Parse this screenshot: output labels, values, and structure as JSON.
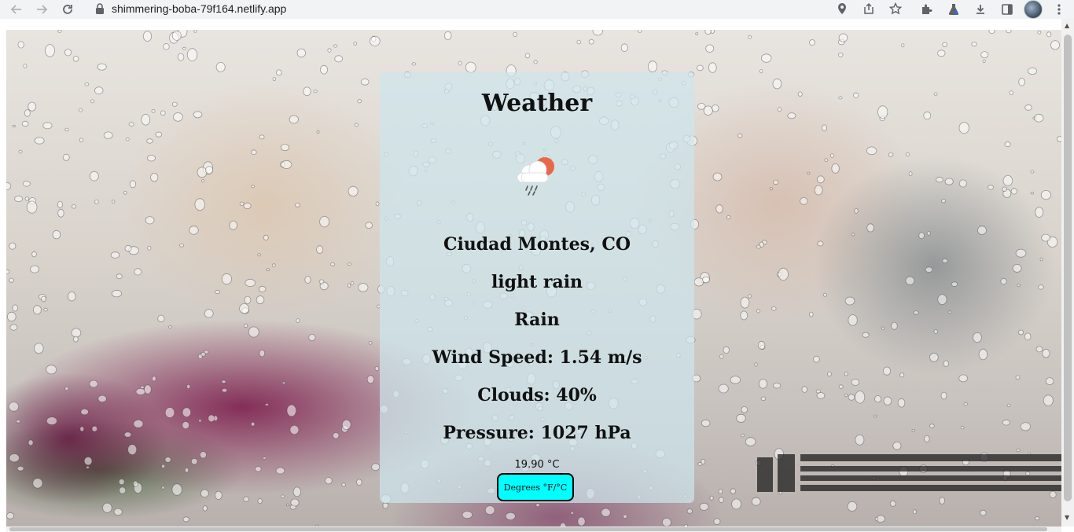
{
  "browser": {
    "url": "shimmering-boba-79f164.netlify.app",
    "icons": {
      "back": "arrow-left-icon",
      "forward": "arrow-right-icon",
      "reload": "reload-icon",
      "lock": "lock-icon",
      "location": "location-pin-icon",
      "share": "share-icon",
      "bookmark": "star-icon",
      "extensions": "puzzle-icon",
      "labs": "flask-icon",
      "download": "download-icon",
      "side_panel": "side-panel-icon",
      "menu": "kebab-menu-icon"
    }
  },
  "weather_card": {
    "title": "Weather",
    "icon": "cloud-rain-sun-icon",
    "location": "Ciudad Montes, CO",
    "description": "light rain",
    "main": "Rain",
    "wind": "Wind Speed: 1.54 m/s",
    "clouds": "Clouds: 40%",
    "pressure": "Pressure: 1027 hPa",
    "temperature": "19.90 °C",
    "unit_button": "Degrees °F/°C"
  },
  "colors": {
    "button_bg": "#00ffff",
    "card_bg": "rgba(205,228,236,0.72)",
    "sun": "#e8684a"
  }
}
